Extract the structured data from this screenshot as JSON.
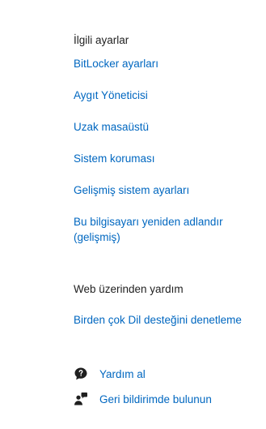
{
  "related_settings": {
    "heading": "İlgili ayarlar",
    "links": [
      "BitLocker ayarları",
      "Aygıt Yöneticisi",
      "Uzak masaüstü",
      "Sistem koruması",
      "Gelişmiş sistem ayarları",
      "Bu bilgisayarı yeniden adlandır (gelişmiş)"
    ]
  },
  "web_help": {
    "heading": "Web üzerinden yardım",
    "links": [
      "Birden çok Dil desteğini denetleme"
    ]
  },
  "support": {
    "get_help": "Yardım al",
    "feedback": "Geri bildirimde bulunun",
    "get_help_icon": "help-chat-icon",
    "feedback_icon": "feedback-person-icon"
  },
  "colors": {
    "link": "#0067c0",
    "text": "#1f1f1f"
  }
}
